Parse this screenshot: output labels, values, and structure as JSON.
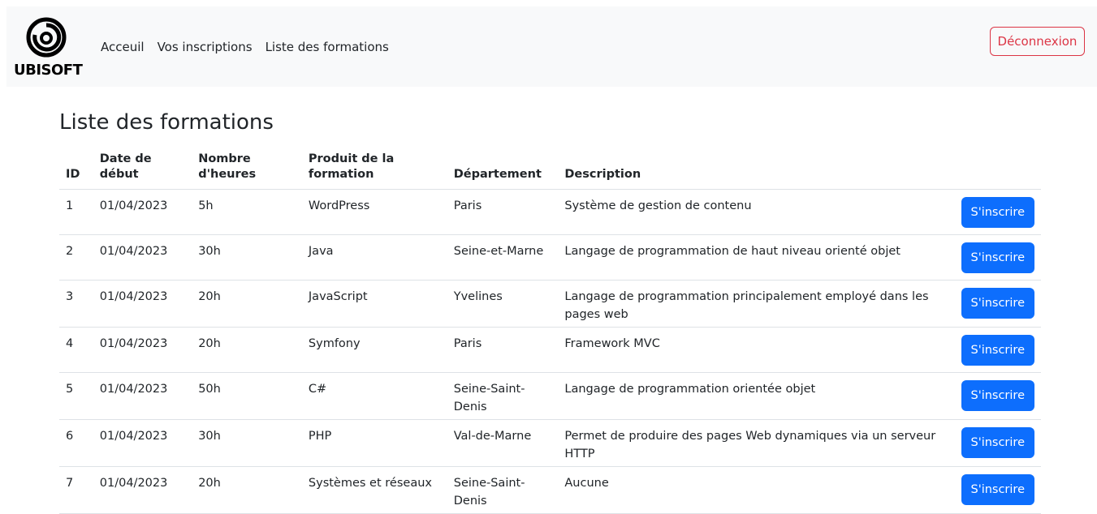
{
  "brand": {
    "logo_text": "UBISOFT"
  },
  "nav": {
    "items": [
      "Acceuil",
      "Vos inscriptions",
      "Liste des formations"
    ],
    "logout_label": "Déconnexion"
  },
  "page": {
    "title": "Liste des formations"
  },
  "table": {
    "headers": {
      "id": "ID",
      "date": "Date de début",
      "hours": "Nombre d'heures",
      "product": "Produit de la formation",
      "department": "Département",
      "description": "Description"
    },
    "rows": [
      {
        "id": "1",
        "date": "01/04/2023",
        "hours": "5h",
        "product": "WordPress",
        "department": "Paris",
        "description": "Système de gestion de contenu",
        "button": "S'inscrire"
      },
      {
        "id": "2",
        "date": "01/04/2023",
        "hours": "30h",
        "product": "Java",
        "department": "Seine-et-Marne",
        "description": "Langage de programmation de haut niveau orienté objet",
        "button": "S'inscrire"
      },
      {
        "id": "3",
        "date": "01/04/2023",
        "hours": "20h",
        "product": "JavaScript",
        "department": "Yvelines",
        "description": "Langage de programmation principalement employé dans les pages web",
        "button": "S'inscrire"
      },
      {
        "id": "4",
        "date": "01/04/2023",
        "hours": "20h",
        "product": "Symfony",
        "department": "Paris",
        "description": "Framework MVC",
        "button": "S'inscrire"
      },
      {
        "id": "5",
        "date": "01/04/2023",
        "hours": "50h",
        "product": "C#",
        "department": "Seine-Saint-Denis",
        "description": "Langage de programmation orientée objet",
        "button": "S'inscrire"
      },
      {
        "id": "6",
        "date": "01/04/2023",
        "hours": "30h",
        "product": "PHP",
        "department": "Val-de-Marne",
        "description": "Permet de produire des pages Web dynamiques via un serveur HTTP",
        "button": "S'inscrire"
      },
      {
        "id": "7",
        "date": "01/04/2023",
        "hours": "20h",
        "product": "Systèmes et réseaux",
        "department": "Seine-Saint-Denis",
        "description": "Aucune",
        "button": "S'inscrire"
      }
    ]
  },
  "colors": {
    "navbar_bg": "#f8f9fa",
    "primary": "#0d6efd",
    "danger": "#dc3545",
    "text": "#212529",
    "border": "#dee2e6"
  }
}
